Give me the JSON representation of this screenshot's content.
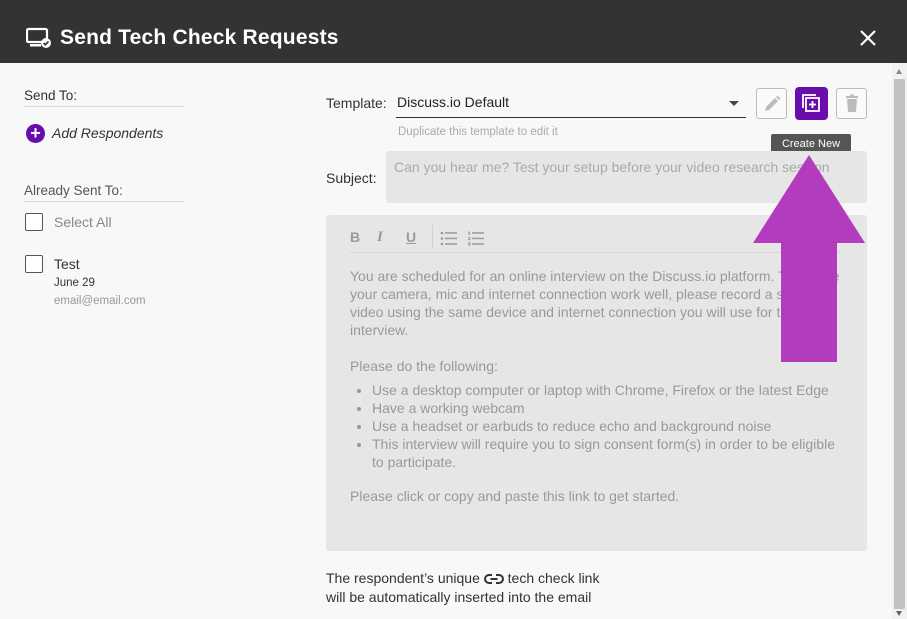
{
  "header": {
    "title": "Send Tech Check Requests",
    "icon": "monitor-check-icon",
    "close_icon": "close-icon"
  },
  "left": {
    "send_to_label": "Send To:",
    "add_respondents_label": "Add Respondents",
    "already_sent_label": "Already Sent To:",
    "select_all_label": "Select All",
    "respondents": [
      {
        "name": "Test",
        "date": "June 29",
        "email": "email@email.com"
      }
    ]
  },
  "template": {
    "label": "Template:",
    "selected": "Discuss.io Default",
    "hint": "Duplicate this template to edit it",
    "tooltip": "Create New",
    "buttons": [
      "pencil-icon",
      "add-copy-icon",
      "trash-icon"
    ]
  },
  "subject": {
    "label": "Subject:",
    "value": "Can you hear me? Test your setup before your video research session"
  },
  "editor": {
    "toolbar": {
      "bold": "B",
      "italic": "I",
      "underline": "U"
    },
    "paragraph1": "You are scheduled for an online interview on the Discuss.io platform. To ensure your camera, mic and internet connection work well, please record a short video using the same device and internet connection you will use for the interview.",
    "paragraph2": "Please do the following:",
    "bullets": [
      "Use a desktop computer or laptop with Chrome, Firefox or the latest Edge",
      "Have a working webcam",
      "Use a headset or earbuds to reduce echo and background noise",
      "This interview will require you to sign consent form(s) in order to be eligible to participate."
    ],
    "paragraph3": "Please click or copy and paste this link to get started."
  },
  "footer": {
    "line1_before": "The respondent’s unique",
    "line1_after": "tech check link",
    "line2": "will be automatically inserted into the email"
  },
  "colors": {
    "header_bg": "#333333",
    "accent": "#6a0dad",
    "annotation_arrow": "#b23cbd"
  }
}
